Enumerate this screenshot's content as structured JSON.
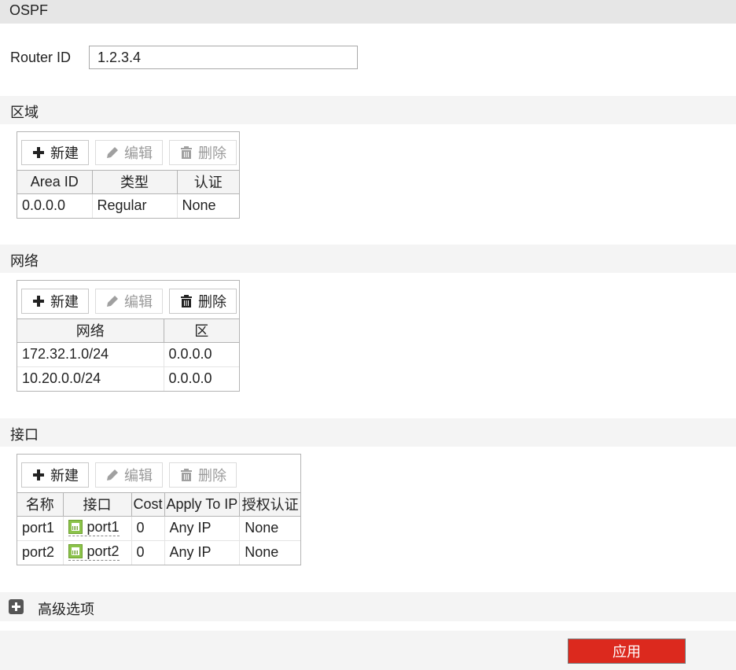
{
  "title": "OSPF",
  "router_id": {
    "label": "Router ID",
    "value": "1.2.3.4"
  },
  "toolbar_labels": {
    "new": "新建",
    "edit": "编辑",
    "delete": "删除"
  },
  "areas": {
    "header": "区域",
    "buttons": {
      "new_enabled": true,
      "edit_enabled": false,
      "delete_enabled": false
    },
    "columns": [
      "Area ID",
      "类型",
      "认证"
    ],
    "rows": [
      {
        "area_id": "0.0.0.0",
        "type": "Regular",
        "auth": "None"
      }
    ]
  },
  "networks": {
    "header": "网络",
    "buttons": {
      "new_enabled": true,
      "edit_enabled": false,
      "delete_enabled": true
    },
    "columns": [
      "网络",
      "区"
    ],
    "rows": [
      {
        "network": "172.32.1.0/24",
        "area": "0.0.0.0"
      },
      {
        "network": "10.20.0.0/24",
        "area": "0.0.0.0"
      }
    ]
  },
  "interfaces": {
    "header": "接口",
    "buttons": {
      "new_enabled": true,
      "edit_enabled": false,
      "delete_enabled": false
    },
    "columns": [
      "名称",
      "接口",
      "Cost",
      "Apply To IP",
      "授权认证"
    ],
    "rows": [
      {
        "name": "port1",
        "interface": "port1",
        "interface_icon": "ethernet-port-icon",
        "cost": "0",
        "apply_to_ip": "Any IP",
        "auth": "None"
      },
      {
        "name": "port2",
        "interface": "port2",
        "interface_icon": "ethernet-port-icon",
        "cost": "0",
        "apply_to_ip": "Any IP",
        "auth": "None"
      }
    ]
  },
  "advanced": {
    "label": "高级选项",
    "icon": "plus-square-icon",
    "expanded": false
  },
  "apply_button": {
    "label": "应用",
    "color": "#dc291e"
  }
}
